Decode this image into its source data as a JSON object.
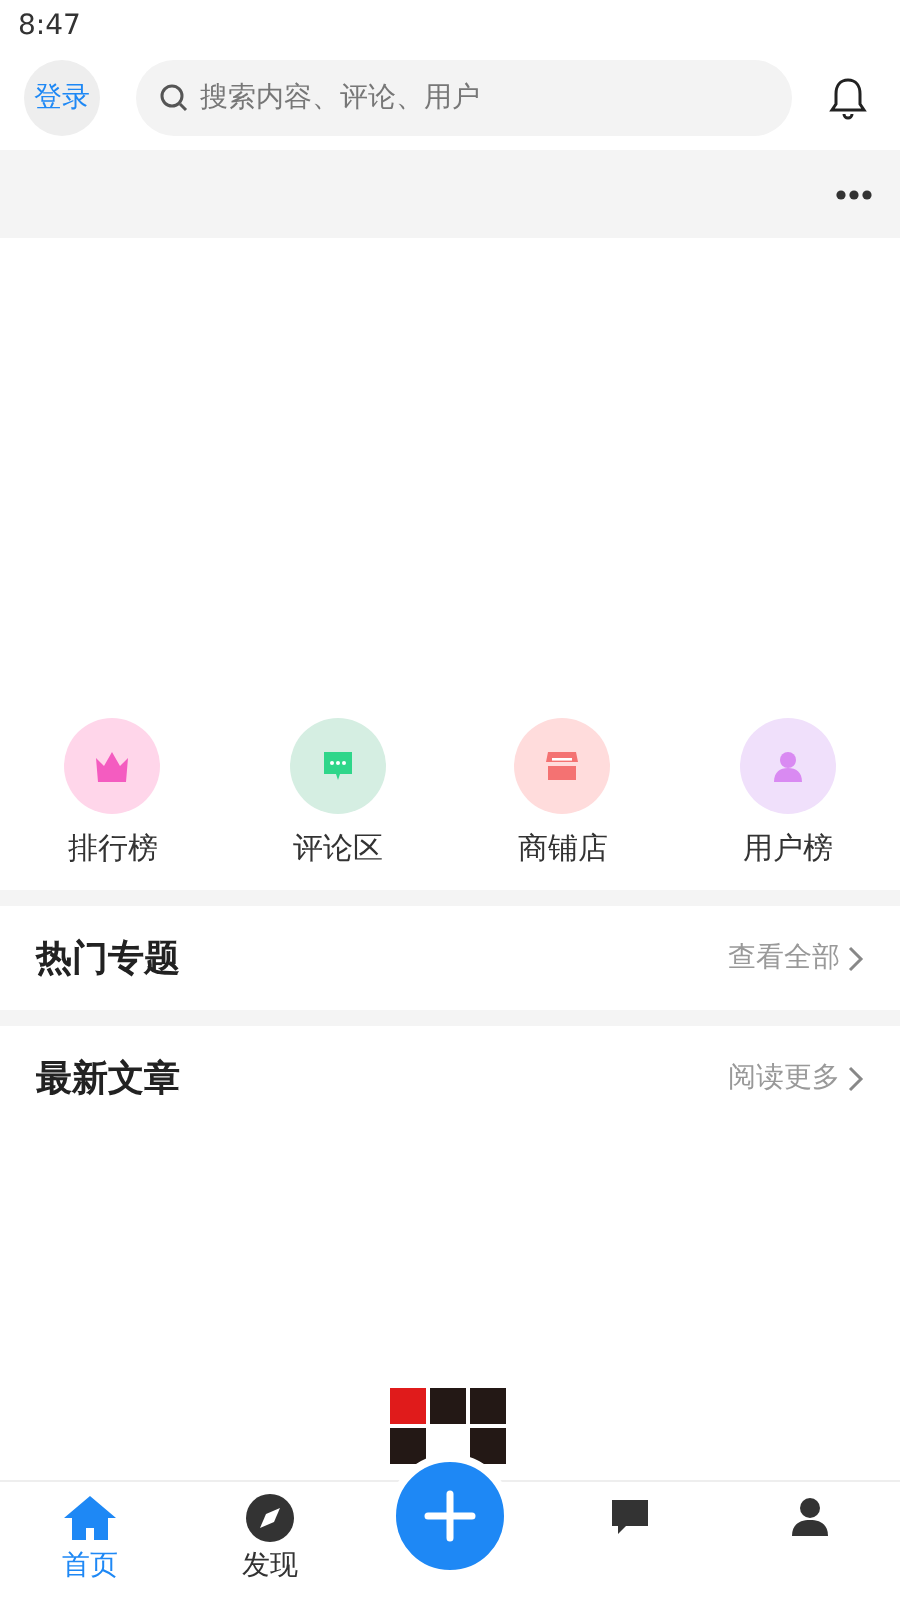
{
  "status_bar": {
    "time": "8:47"
  },
  "header": {
    "login": "登录",
    "search": {
      "placeholder": "搜索内容、评论、用户"
    }
  },
  "shortcuts": [
    {
      "label": "排行榜",
      "kind": "crown",
      "color": "#ffd6ea"
    },
    {
      "label": "评论区",
      "kind": "comment",
      "color": "#d5eee2"
    },
    {
      "label": "商铺店",
      "kind": "shop",
      "color": "#ffdcdc"
    },
    {
      "label": "用户榜",
      "kind": "user",
      "color": "#f0e0fb"
    }
  ],
  "sections": [
    {
      "title": "热门专题",
      "link": "查看全部"
    },
    {
      "title": "最新文章",
      "link": "阅读更多"
    }
  ],
  "tab_bar": [
    {
      "kind": "home",
      "label": "首页",
      "selected": true
    },
    {
      "kind": "discover",
      "label": "发现",
      "selected": false
    },
    {
      "kind": "add",
      "selected": false
    },
    {
      "kind": "message",
      "selected": false
    },
    {
      "kind": "me",
      "selected": false
    }
  ]
}
